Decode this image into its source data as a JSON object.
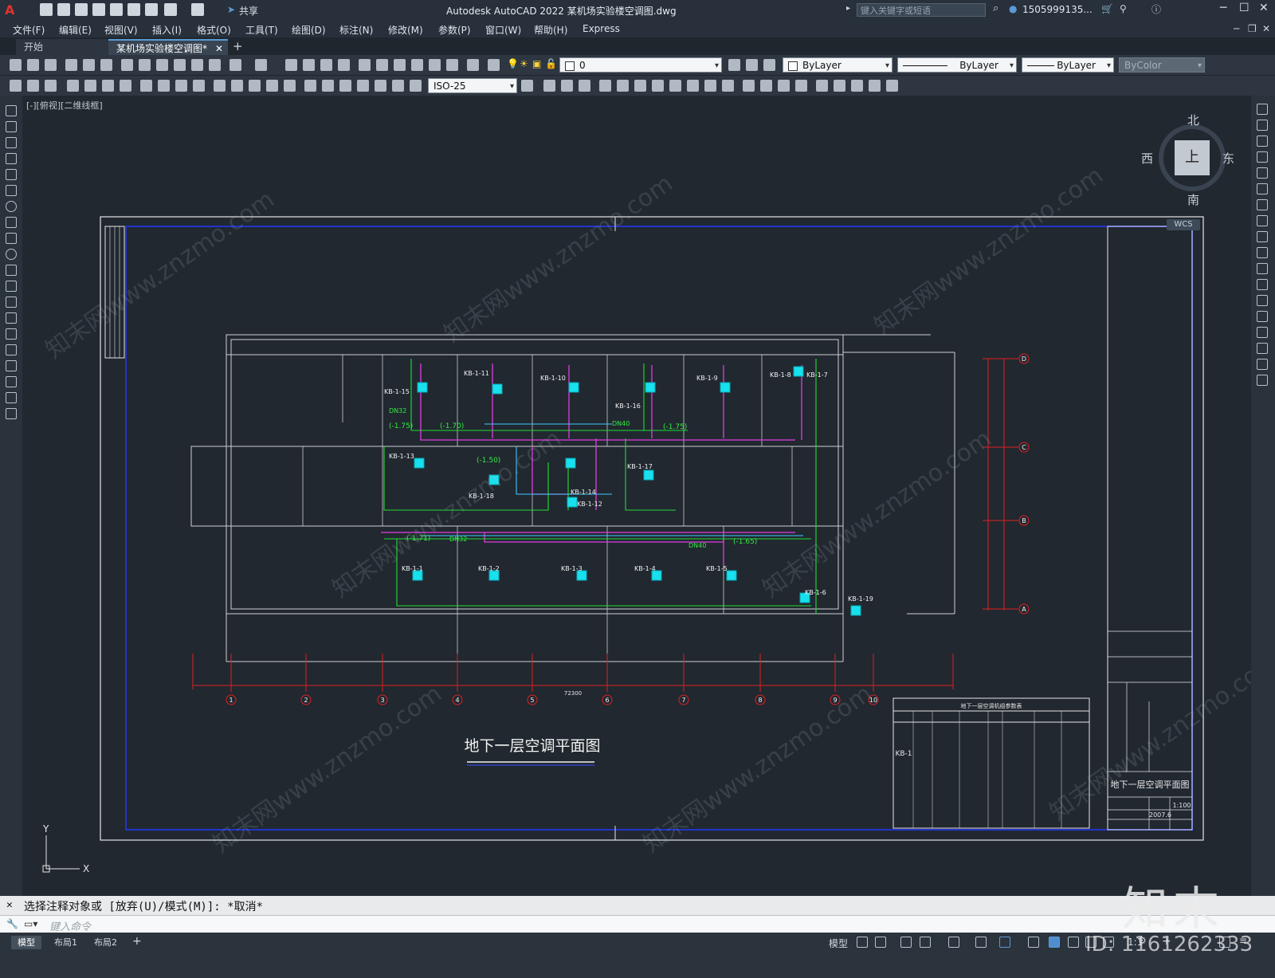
{
  "app": {
    "title": "Autodesk AutoCAD 2022    某机场实验楼空调图.dwg",
    "search_placeholder": "键入关键字或短语",
    "user": "1505999135...",
    "share_label": "共享"
  },
  "menu": [
    "文件(F)",
    "编辑(E)",
    "视图(V)",
    "插入(I)",
    "格式(O)",
    "工具(T)",
    "绘图(D)",
    "标注(N)",
    "修改(M)",
    "参数(P)",
    "窗口(W)",
    "帮助(H)",
    "Express"
  ],
  "tabs": {
    "start": "开始",
    "drawing": "某机场实验楼空调图*"
  },
  "toolbar": {
    "layer": "0",
    "color": "ByLayer",
    "linetype": "ByLayer",
    "lineweight": "ByLayer",
    "plotstyle": "ByColor",
    "dimstyle": "ISO-25"
  },
  "viewport": {
    "label": "[-][俯视][二维线框]",
    "viewcube": {
      "north": "北",
      "south": "南",
      "east": "东",
      "west": "西",
      "face": "上"
    },
    "wcs": "WCS"
  },
  "drawing": {
    "title": "地下一层空调平面图",
    "titleblock_name": "地下一层空调平面图",
    "scale": "1:100",
    "date": "2007.6",
    "table_title": "地下一层空调机组参数表",
    "unit_group": "KB-1",
    "grid_numbers": [
      "1",
      "2",
      "3",
      "4",
      "5",
      "6",
      "7",
      "8",
      "9",
      "10"
    ],
    "grid_letters": [
      "D",
      "C",
      "B",
      "A"
    ],
    "total_dimension": "72300",
    "unit_labels": [
      "KB-1-11",
      "KB-1-10",
      "KB-1-9",
      "KB-1-8",
      "KB-1-7",
      "KB-1-15",
      "KB-1-16",
      "KB-1-13",
      "KB-1-17",
      "KB-1-14",
      "KB-1-18",
      "KB-1-12",
      "KB-1-1",
      "KB-1-2",
      "KB-1-3",
      "KB-1-4",
      "KB-1-5",
      "KB-1-6",
      "KB-1-19"
    ],
    "elevations": [
      "(-1.75)",
      "(-1.70)",
      "(-1.75)",
      "(-1.50)",
      "(-1.71)",
      "(-1.65)"
    ],
    "pipe_labels": [
      "DN32",
      "DN40"
    ]
  },
  "command": {
    "history": "选择注释对象或 [放弃(U)/模式(M)]: *取消*",
    "placeholder": "键入命令"
  },
  "status": {
    "layouts": [
      "模型",
      "布局1",
      "布局2"
    ],
    "model_label": "模型",
    "scale": "1:1"
  },
  "watermark": {
    "brand": "知末",
    "id": "ID: 1161262333",
    "site": "知末网www.znzmo.com"
  }
}
